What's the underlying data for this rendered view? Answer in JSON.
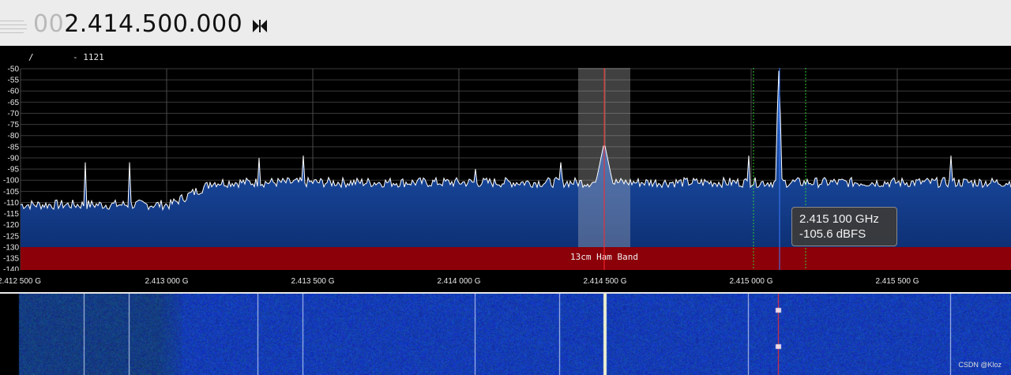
{
  "header": {
    "frequency_leading": "00",
    "frequency_digits": "2.414.500.000",
    "mode_icon": "bowtie-icon"
  },
  "spectrum": {
    "status_left": "/",
    "status_value": "- 1121",
    "y_labels": [
      "-50",
      "-55",
      "-60",
      "-65",
      "-70",
      "-75",
      "-80",
      "-85",
      "-90",
      "-95",
      "-100",
      "-105",
      "-110",
      "-115",
      "-120",
      "-125",
      "-130",
      "-135",
      "-140"
    ],
    "x_labels": [
      "2.412 500 G",
      "2.413 000 G",
      "2.413 500 G",
      "2.414 000 G",
      "2.414 500 G",
      "2.415 000 G",
      "2.415 500 G"
    ],
    "band_label": "13cm Ham Band",
    "colors": {
      "band": "#8c0009",
      "trace": "#ffffff",
      "fill_top": "#2a6fd1",
      "center_line": "#ff2a2a",
      "cursor_line": "#3a7bff",
      "edge_line": "#2ecc2e"
    }
  },
  "tooltip": {
    "freq": "2.415 100 GHz",
    "level": "-105.6 dBFS"
  },
  "watermark": "CSDN @Kloz"
}
